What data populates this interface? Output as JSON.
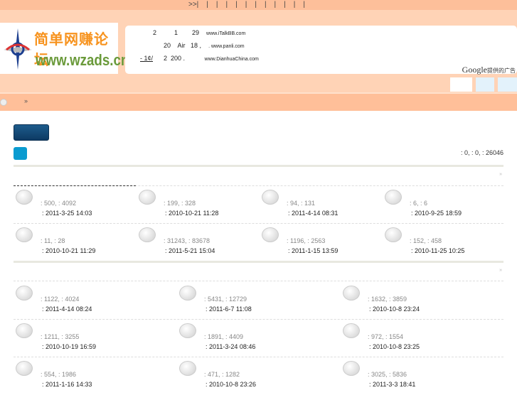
{
  "top_nav": {
    "items": [
      ">>|",
      "|",
      "|",
      "|",
      "|",
      "|",
      "|",
      "|",
      "|",
      "|",
      "|",
      "|"
    ]
  },
  "logo": {
    "cn": "简单网赚论坛",
    "en": "www.wzads.cn"
  },
  "ads": {
    "lines": [
      {
        "link": "",
        "tail": "2          1        29",
        "url": "www.iTalkBB.com"
      },
      {
        "link": "",
        "tail": "      20    Air   18 ,",
        "url": ". www.panli.com"
      },
      {
        "link": "- 1¢/",
        "tail": "      2  200 .",
        "url": "www.DianhuaChina.com"
      }
    ],
    "google": "Google",
    "google_suffix": "提供的广告"
  },
  "nav": {
    "separator": "»"
  },
  "board_stats": ": 0,  : 0,  : 26046",
  "section_arrow": "»",
  "section1": [
    {
      "stats": ": 500,  : 4092",
      "date": ": 2011-3-25 14:03"
    },
    {
      "stats": ": 199,  : 328",
      "date": ": 2010-10-21 11:28"
    },
    {
      "stats": ": 94,  : 131",
      "date": ": 2011-4-14 08:31"
    },
    {
      "stats": ": 6,  : 6",
      "date": ": 2010-9-25 18:59"
    },
    {
      "stats": ": 11,  : 28",
      "date": ": 2010-10-21 11:29"
    },
    {
      "stats": ": 31243,  : 83678",
      "date": ": 2011-5-21 15:04"
    },
    {
      "stats": ": 1196,  : 2563",
      "date": ": 2011-1-15 13:59"
    },
    {
      "stats": ": 152,  : 458",
      "date": ": 2010-11-25 10:25"
    }
  ],
  "section2": [
    {
      "stats": ": 1122,  : 4024",
      "date": ": 2011-4-14 08:24"
    },
    {
      "stats": ": 5431,  : 12729",
      "date": ": 2011-6-7 11:08"
    },
    {
      "stats": ": 1632,  : 3859",
      "date": ": 2010-10-8 23:24"
    },
    {
      "stats": ": 1211,  : 3255",
      "date": ": 2010-10-19 16:59"
    },
    {
      "stats": ": 1891,  : 4409",
      "date": ": 2011-3-24 08:46"
    },
    {
      "stats": ": 972,  : 1554",
      "date": ": 2010-10-8 23:25"
    },
    {
      "stats": ": 554,  : 1986",
      "date": ": 2011-1-16 14:33"
    },
    {
      "stats": ": 471,  : 1282",
      "date": ": 2010-10-8 23:26"
    },
    {
      "stats": ": 3025,  : 5836",
      "date": ": 2011-3-3 18:41"
    }
  ]
}
